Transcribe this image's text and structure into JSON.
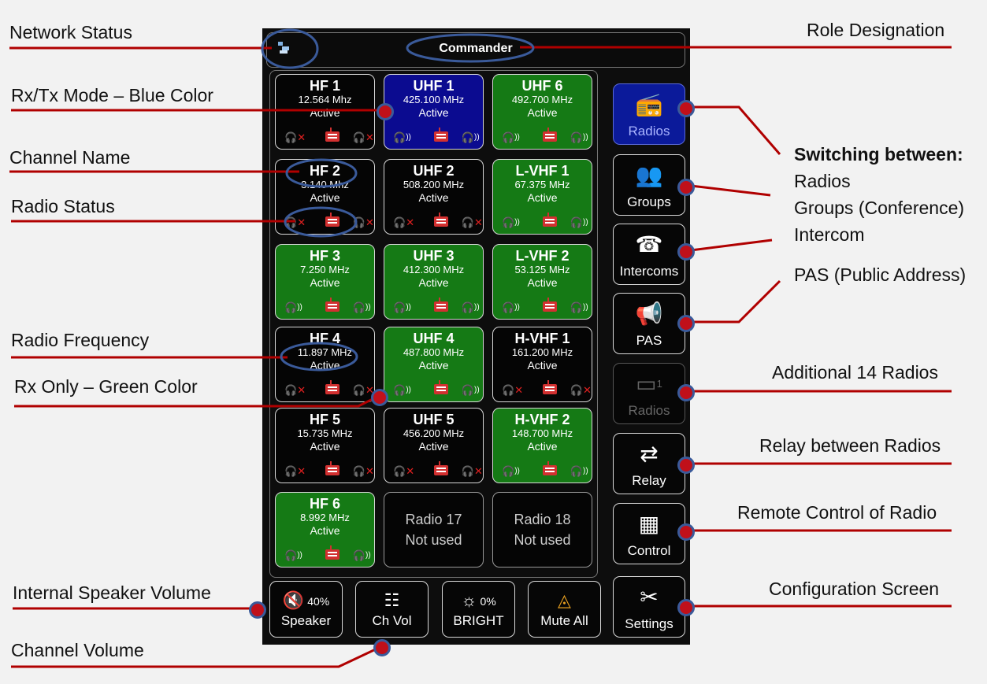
{
  "annotations": {
    "network_status": "Network Status",
    "rxtx_mode": "Rx/Tx Mode – Blue Color",
    "channel_name": "Channel Name",
    "radio_status": "Radio Status",
    "radio_frequency": "Radio Frequency",
    "rx_only": "Rx Only –  Green Color",
    "internal_speaker_volume": "Internal Speaker Volume",
    "channel_volume": "Channel Volume",
    "role_designation": "Role Designation",
    "switching_title": "Switching between:",
    "switching_items": [
      "Radios",
      "Groups (Conference)",
      "Intercom"
    ],
    "pas": "PAS (Public Address)",
    "additional_radios": "Additional 14 Radios",
    "relay": "Relay between Radios",
    "remote_control": "Remote Control of Radio",
    "configuration": "Configuration Screen"
  },
  "header": {
    "role": "Commander",
    "network_icon": "network-icon"
  },
  "tiles": [
    {
      "name": "HF 1",
      "freq": "12.564 Mhz",
      "status": "Active",
      "mode": "black",
      "icons": "off"
    },
    {
      "name": "UHF 1",
      "freq": "425.100 MHz",
      "status": "Active",
      "mode": "blue",
      "icons": "on"
    },
    {
      "name": "UHF 6",
      "freq": "492.700 MHz",
      "status": "Active",
      "mode": "green",
      "icons": "on"
    },
    {
      "name": "HF 2",
      "freq": "3.140 Mhz",
      "status": "Active",
      "mode": "black",
      "icons": "off"
    },
    {
      "name": "UHF 2",
      "freq": "508.200 MHz",
      "status": "Active",
      "mode": "black",
      "icons": "off"
    },
    {
      "name": "L-VHF 1",
      "freq": "67.375 MHz",
      "status": "Active",
      "mode": "green",
      "icons": "on"
    },
    {
      "name": "HF 3",
      "freq": "7.250 MHz",
      "status": "Active",
      "mode": "green",
      "icons": "on"
    },
    {
      "name": "UHF 3",
      "freq": "412.300 MHz",
      "status": "Active",
      "mode": "green",
      "icons": "on"
    },
    {
      "name": "L-VHF 2",
      "freq": "53.125 MHz",
      "status": "Active",
      "mode": "green",
      "icons": "on"
    },
    {
      "name": "HF 4",
      "freq": "11.897 MHz",
      "status": "Active",
      "mode": "black",
      "icons": "off"
    },
    {
      "name": "UHF 4",
      "freq": "487.800 MHz",
      "status": "Active",
      "mode": "green",
      "icons": "on"
    },
    {
      "name": "H-VHF 1",
      "freq": "161.200 MHz",
      "status": "Active",
      "mode": "black",
      "icons": "off"
    },
    {
      "name": "HF 5",
      "freq": "15.735 MHz",
      "status": "Active",
      "mode": "black",
      "icons": "off"
    },
    {
      "name": "UHF 5",
      "freq": "456.200 MHz",
      "status": "Active",
      "mode": "black",
      "icons": "off"
    },
    {
      "name": "H-VHF 2",
      "freq": "148.700 MHz",
      "status": "Active",
      "mode": "green",
      "icons": "on"
    },
    {
      "name": "HF 6",
      "freq": "8.992 MHz",
      "status": "Active",
      "mode": "green",
      "icons": "on"
    }
  ],
  "unused": [
    {
      "name": "Radio  17",
      "status": "Not used"
    },
    {
      "name": "Radio  18",
      "status": "Not used"
    }
  ],
  "side": [
    {
      "label": "Radios",
      "icon": "radio-icon",
      "glyph": "📻",
      "state": "active"
    },
    {
      "label": "Groups",
      "icon": "groups-icon",
      "glyph": "👥",
      "state": "normal"
    },
    {
      "label": "Intercoms",
      "icon": "intercom-icon",
      "glyph": "☎",
      "state": "normal"
    },
    {
      "label": "PAS",
      "icon": "megaphone-icon",
      "glyph": "📢",
      "state": "normal"
    },
    {
      "label": "Radios",
      "icon": "screen-icon",
      "glyph": "▭",
      "badge": "1",
      "state": "dim"
    },
    {
      "label": "Relay",
      "icon": "relay-icon",
      "glyph": "⇄",
      "state": "normal"
    },
    {
      "label": "Control",
      "icon": "keypad-icon",
      "glyph": "▦",
      "state": "normal"
    },
    {
      "label": "Settings",
      "icon": "tools-icon",
      "glyph": "✂",
      "state": "normal"
    }
  ],
  "bottom": [
    {
      "label": "Speaker",
      "value": "40%",
      "icon": "speaker-muted-icon",
      "glyph": "🔇"
    },
    {
      "label": "Ch Vol",
      "value": "",
      "icon": "sliders-icon",
      "glyph": "☷"
    },
    {
      "label": "BRIGHT",
      "value": "0%",
      "icon": "brightness-icon",
      "glyph": "☼"
    },
    {
      "label": "Mute All",
      "value": "",
      "icon": "mute-all-icon",
      "glyph": "◬"
    }
  ],
  "colors": {
    "blue": "#0b0b90",
    "green": "#157a15",
    "marker": "#c0101a",
    "line": "#b00000"
  }
}
